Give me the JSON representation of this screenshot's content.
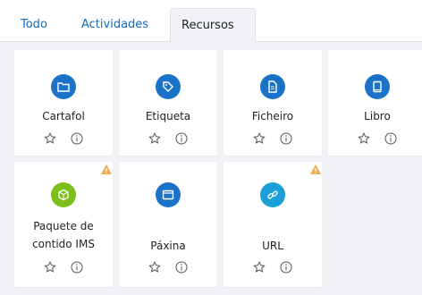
{
  "tabs": [
    {
      "label": "Todo"
    },
    {
      "label": "Actividades"
    },
    {
      "label": "Recursos"
    }
  ],
  "cards": [
    {
      "label": "Cartafol",
      "icon": "folder-icon",
      "color": "#1a73c8"
    },
    {
      "label": "Etiqueta",
      "icon": "tag-icon",
      "color": "#1a73c8"
    },
    {
      "label": "Ficheiro",
      "icon": "file-icon",
      "color": "#1a73c8"
    },
    {
      "label": "Libro",
      "icon": "book-icon",
      "color": "#1a73c8"
    },
    {
      "label_line1": "Paquete de",
      "label_line2": "contido IMS",
      "icon": "package-icon",
      "color": "#7cbf1a"
    },
    {
      "label": "Páxina",
      "icon": "page-icon",
      "color": "#1a73c8"
    },
    {
      "label": "URL",
      "icon": "link-icon",
      "color": "#1a9fd8"
    }
  ],
  "colors": {
    "accent": "#0f6cbf",
    "warning": "#f0ad4e"
  }
}
